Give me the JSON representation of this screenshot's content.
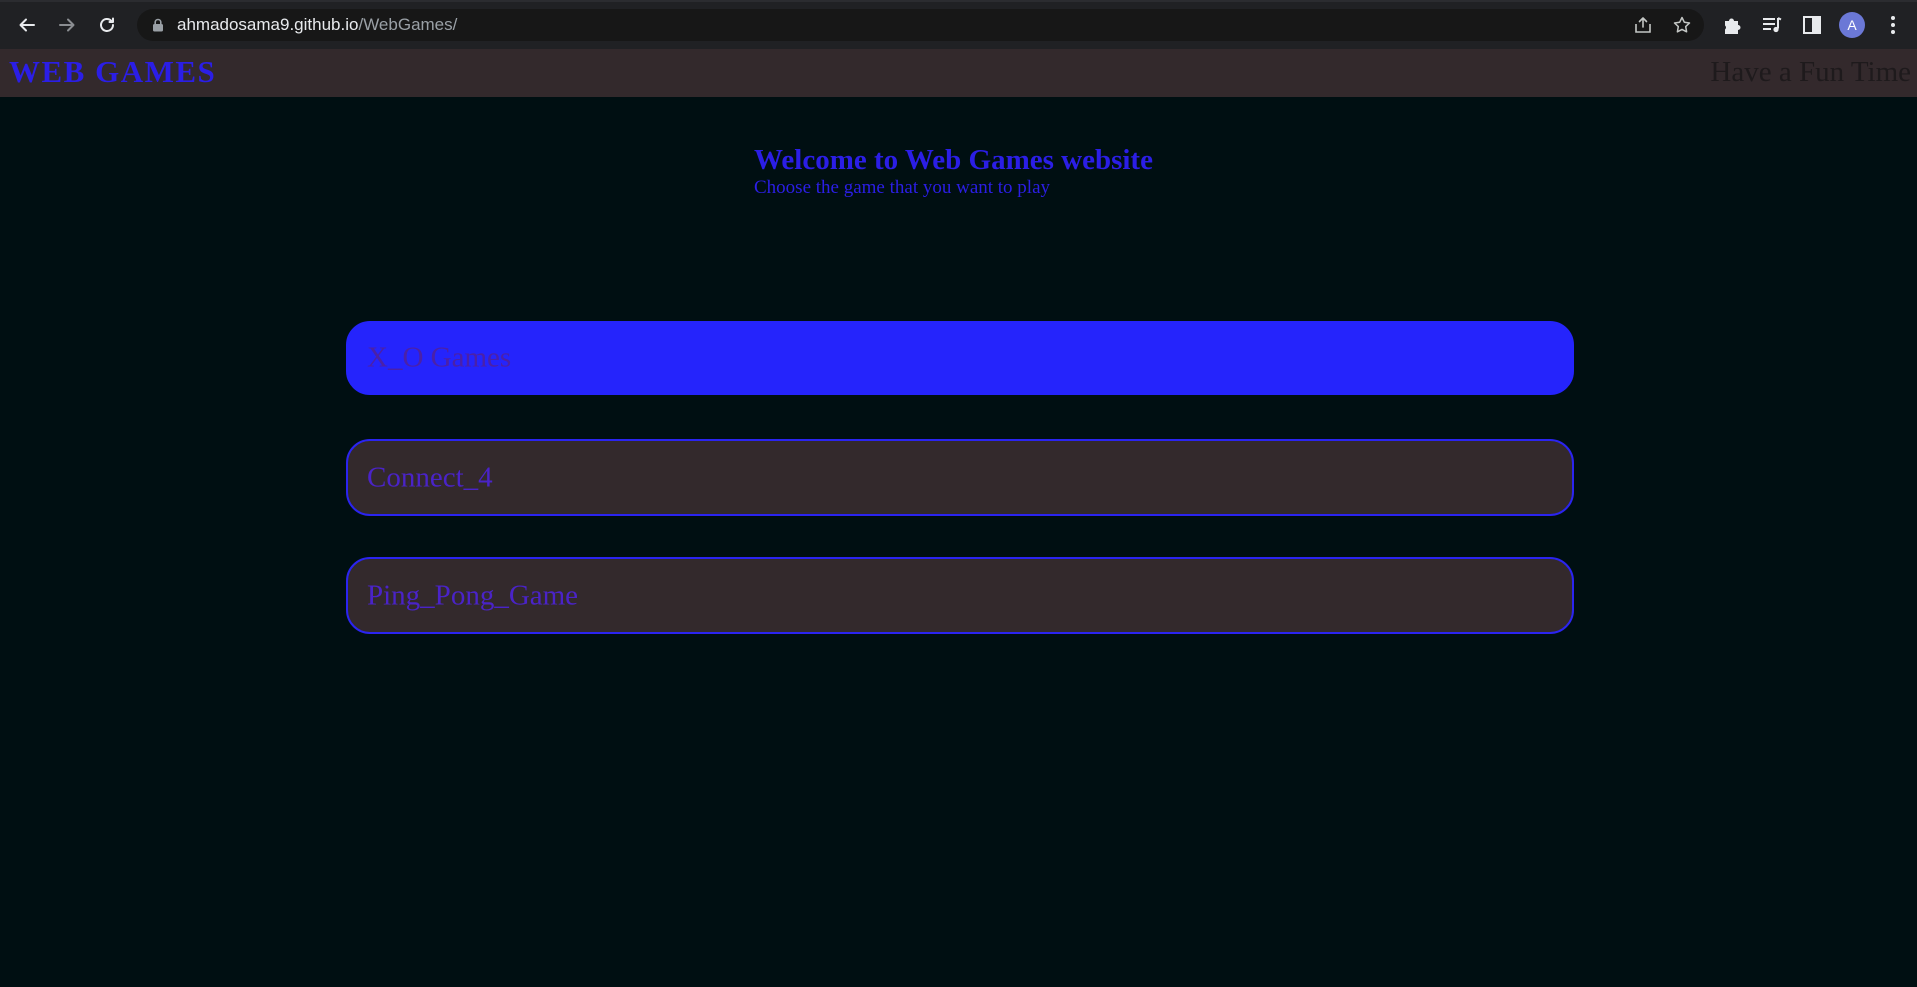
{
  "browser": {
    "url_host": "ahmadosama9.github.io",
    "url_path": "/WebGames/",
    "profile_initial": "A",
    "icons": [
      "back-arrow-icon",
      "forward-arrow-icon",
      "reload-icon",
      "lock-icon",
      "share-icon",
      "bookmark-star-icon",
      "extensions-puzzle-icon",
      "media-queue-icon",
      "side-panel-icon",
      "kebab-menu-icon"
    ]
  },
  "header": {
    "logo": "WEB GAMES",
    "tagline": "Have a Fun Time"
  },
  "welcome": {
    "title": "Welcome to Web Games website",
    "subtitle": "Choose the game that you want to play"
  },
  "games": [
    {
      "label": "X_O Games",
      "active": true
    },
    {
      "label": "Connect_4",
      "active": false
    },
    {
      "label": "Ping_Pong_Game",
      "active": false
    }
  ],
  "colors": {
    "page_background": "#000f12",
    "header_background": "#33292c",
    "accent_blue": "#2524fc",
    "text_blue": "#2b1ee6",
    "button_label_purple": "#4a23c8"
  }
}
